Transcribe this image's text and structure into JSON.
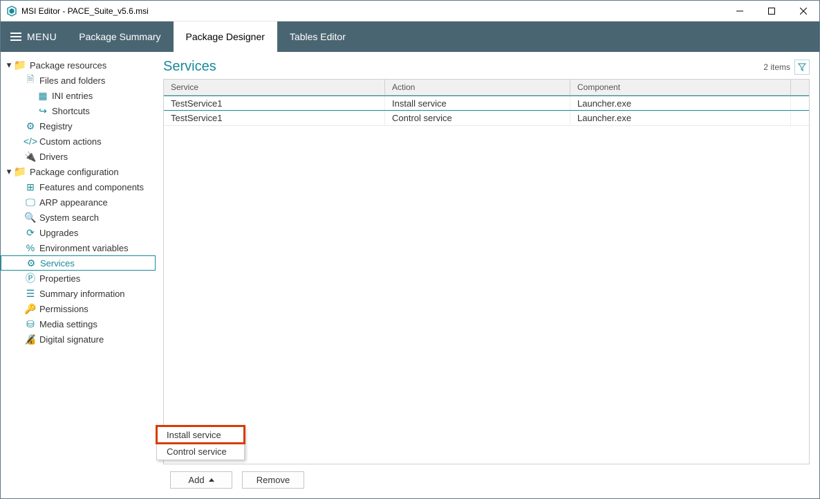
{
  "window": {
    "title": "MSI Editor - PACE_Suite_v5.6.msi"
  },
  "menu_label": "MENU",
  "tabs": {
    "summary": "Package Summary",
    "designer": "Package Designer",
    "tables": "Tables Editor"
  },
  "sidebar": {
    "group_resources": "Package resources",
    "files_folders": "Files and folders",
    "ini_entries": "INI entries",
    "shortcuts": "Shortcuts",
    "registry": "Registry",
    "custom_actions": "Custom actions",
    "drivers": "Drivers",
    "group_config": "Package configuration",
    "features": "Features and components",
    "arp": "ARP appearance",
    "system_search": "System search",
    "upgrades": "Upgrades",
    "env_vars": "Environment variables",
    "services": "Services",
    "properties": "Properties",
    "summary_info": "Summary information",
    "permissions": "Permissions",
    "media": "Media settings",
    "digital_sig": "Digital signature"
  },
  "page": {
    "title": "Services",
    "count": "2 items"
  },
  "table": {
    "headers": {
      "service": "Service",
      "action": "Action",
      "component": "Component"
    },
    "rows": [
      {
        "service": "TestService1",
        "action": "Install service",
        "component": "Launcher.exe"
      },
      {
        "service": "TestService1",
        "action": "Control service",
        "component": "Launcher.exe"
      }
    ]
  },
  "popup": {
    "install": "Install service",
    "control": "Control service"
  },
  "buttons": {
    "add": "Add",
    "remove": "Remove"
  }
}
